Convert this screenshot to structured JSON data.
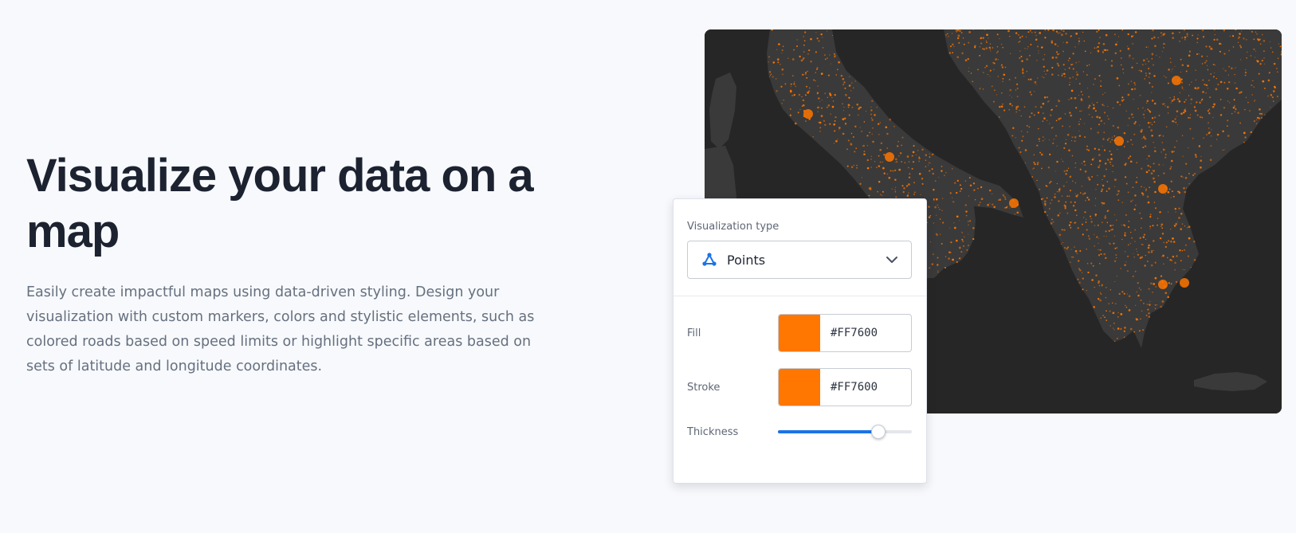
{
  "hero": {
    "headline_line1": "Visualize your data on a",
    "headline_line2": "map",
    "description": "Easily create impactful maps using data-driven styling. Design your visualization with custom markers, colors and stylistic elements, such as colored roads based on speed limits or highlight specific areas based on sets of latitude and longitude coordinates."
  },
  "map": {
    "background_color": "#262626",
    "land_color": "#3a3a3a",
    "road_color": "#FF7600"
  },
  "panel": {
    "visualization_type_label": "Visualization type",
    "visualization_type_value": "Points",
    "visualization_type_icon": "points-triangle-icon",
    "fill_label": "Fill",
    "fill_hex": "#FF7600",
    "stroke_label": "Stroke",
    "stroke_hex": "#FF7600",
    "thickness_label": "Thickness",
    "thickness_fraction": 0.75,
    "accent_color": "#1a73e8"
  }
}
